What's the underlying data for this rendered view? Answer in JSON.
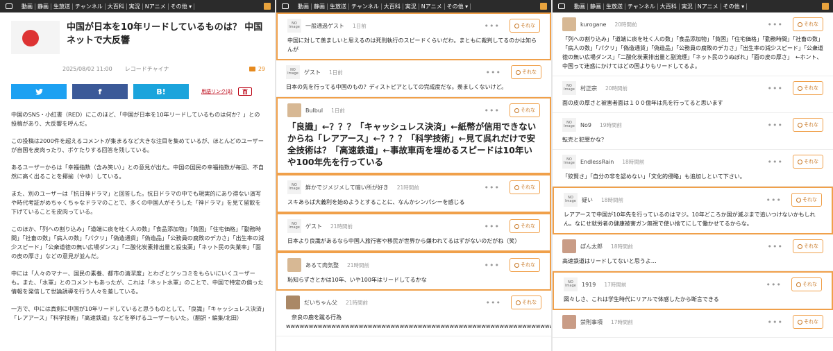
{
  "topbar": {
    "items": [
      "動画",
      "静画",
      "生放送",
      "チャンネル",
      "大百科",
      "実況",
      "Nアニメ",
      "その他 ▾"
    ]
  },
  "article": {
    "title": "中国が日本を10年リードしているものは？ 中国ネットで大反響",
    "date": "2025/08/02 11:00",
    "source": "レコードチャイナ",
    "comment_count": "29",
    "share": {
      "twitter": "",
      "facebook": "f",
      "hatena": "B!"
    },
    "glossary_link": "用語リンク(β)",
    "dict_badge": "百",
    "paragraphs": [
      "中国のSNS・小紅書（RED）にこのほど、「中国が日本を10年リードしているものは何か？」との投稿があり、大反響を呼んだ。",
      "この投稿は2000件を超えるコメントが集まるなど大きな注目を集めているが、ほとんどのユーザーが自国を皮肉ったり、ボケたりする回答を残している。",
      "あるユーザーからは「幸福指数（含み笑い）」との意見が出た。中国の国民の幸福指数が毎回、不自然に高く出ることを揶揄（やゆ）している。",
      "また、別のユーザーは「抗日神ドラマ」と回答した。抗日ドラマの中でも現実的にあり得ない演写や時代考証がめちゃくちゃなドラマのことで、多くの中国人がそうした「神ドラマ」を見て留飲を下げていることを皮肉っている。",
      "このほか、「列への割り込み」「道端に痰を吐く人の数」「食品添加物」「貧困」「住宅価格」「勤務時間」「社畜の数」「病人の数」「パクリ」「偽造通貨」「偽造品」「公務員の腐敗のデカさ」「出生率の減少スピード」「公衆道徳の無い広場ダンス」「二酸化炭素排出量と殺虫薬」「ネット民の失業率」「面の皮の厚さ」などの意見が並んだ。",
      "中には「人々のマナー、国民の素養、都市の清潔度」とわざとツッコミをもらいにいくユーザーも。また、「水軍」とのコメントもあったが、これは「ネット水軍」のことで、中国で特定の偏った情報を発信して世論誘導を行う人々を差している。",
      "一方で、中には真剣に中国が10年リードしていると思うものとして、「良識」「キャッシュレス決済」「レアアース」「科学技術」「高速鉄道」などを挙げるユーザーもいた。（翻訳・編集/北田）"
    ]
  },
  "reaction_label": "それな",
  "col2": [
    {
      "user": "一般通過ゲスト",
      "time": "1日前",
      "avatar": "NO Image",
      "text": "中国に対して羨ましいと思えるのは死刑執行のスピードくらいだわ。まともに裁判してるのかは知らんが",
      "hl": true
    },
    {
      "user": "ゲスト",
      "time": "1日前",
      "avatar": "NO Image",
      "text": "日本の先を行ってる中国のもの？ディストピアとしての完成度だな。羨ましくないけど。",
      "hl": false
    },
    {
      "user": "Bulbul",
      "time": "1日前",
      "avatar": "img",
      "text": "「良識」←？？？「キャッシュレス決済」←紙幣が信用できないからね「レアアース」←？？？「科学技術」←見て呉れだけで安全技術は？「高速鉄道」←事故車両を埋めるスピードは10年いや100年先を行っている",
      "hl": true,
      "big": true
    },
    {
      "user": "鮮かでジメジメして暗い所が好き",
      "time": "21時間前",
      "avatar": "NO Image",
      "text": "スキあらば大義利を始めようとすることに、なんかシンパシーを感じる",
      "hl": true
    },
    {
      "user": "ゲスト",
      "time": "21時間前",
      "avatar": "NO Image",
      "text": "日本より良識があるなら中国人旅行客や移民が世界から嫌われてるはずがないのだがね（笑）",
      "hl": true
    },
    {
      "user": "あるて肉気整",
      "time": "21時間前",
      "avatar": "img",
      "text": "恥知らずさとかは10年、いや100年はリードしてるかな",
      "hl": true
    },
    {
      "user": "だいちゃん父",
      "time": "21時間前",
      "avatar": "img2",
      "text": "　奈良の鹿を蹴る行為wwwwwwwwwwwwwwwwwwwwwwwwwwwwwwwwwwwwwwwwwwwwwwwwwwwwwwwwwwwwwwwwwwwwwwwwwwwwwwwww",
      "hl": false
    }
  ],
  "col3": [
    {
      "user": "kurogane",
      "time": "20時間前",
      "avatar": "img",
      "text": "「列への割り込み」「道端に痰を吐く人の数」「食品添加物」「貧困」「住宅価格」「勤務時間」「社畜の数」「病人の数」「パクリ」「偽造通貨」「偽造品」「公務員の腐敗のデカさ」「出生率の減少スピード」「公衆道徳の無い広場ダンス」「二酸化炭素排出量と副流煙」「ネット民のうぬぼれ」「面の皮の厚さ」　←ホント、中国って迷惑にかけてはどの国よりもリードしてるよ。",
      "hl": false
    },
    {
      "user": "村正宗",
      "time": "20時間前",
      "avatar": "NO Image",
      "text": "面の皮の厚さと被害者面は１００億年は先を行ってると思います",
      "hl": false
    },
    {
      "user": "No9",
      "time": "19時間前",
      "avatar": "NO Image",
      "text": "転売と犯罪かな？",
      "hl": false
    },
    {
      "user": "EndlessRain",
      "time": "18時間前",
      "avatar": "NO Image",
      "text": "「狡賢さ」「自分の非を認めない」「文化的侵略」も追加しといて下さい。",
      "hl": false
    },
    {
      "user": "疑い",
      "time": "18時間前",
      "avatar": "NO Image",
      "text": "レアアースで中国が10年先を行っているのはマジ。10年どころか国が滅ぶまで追いつけないかもしれん。なにせ就労者の健康被害ガン無視で使い捨てにして働かせてるからな。",
      "hl": true
    },
    {
      "user": "ぽん太郎",
      "time": "18時間前",
      "avatar": "img3",
      "text": "高速鉄道はリードしてないと思うよ…",
      "hl": false
    },
    {
      "user": "1919",
      "time": "17時間前",
      "avatar": "NO Image",
      "text": "図々しさ、これは学生時代にリアルで体感したから断言できる",
      "hl": true
    },
    {
      "user": "禁則事項",
      "time": "17時間前",
      "avatar": "img3",
      "text": "",
      "hl": false
    }
  ]
}
